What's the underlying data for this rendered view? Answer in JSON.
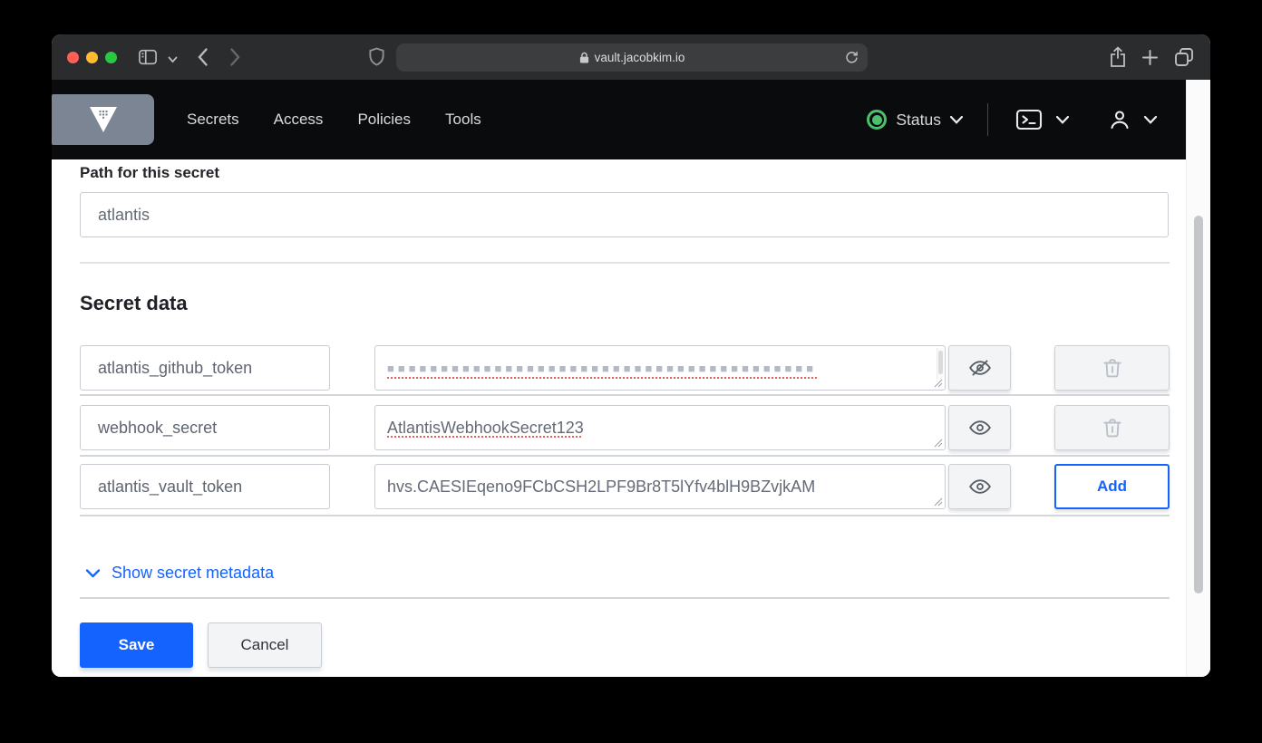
{
  "browser": {
    "url": "vault.jacobkim.io"
  },
  "nav": {
    "links": [
      "Secrets",
      "Access",
      "Policies",
      "Tools"
    ],
    "status_label": "Status"
  },
  "form": {
    "path_label": "Path for this secret",
    "path_value": "atlantis",
    "section_title": "Secret data",
    "rows": [
      {
        "key": "atlantis_github_token",
        "value": "■■■■■■■■■■■■■■■■■■■■■■■■■■■■■■■■■■■■■■■■",
        "masked": true
      },
      {
        "key": "webhook_secret",
        "value": "AtlantisWebhookSecret123",
        "masked": false
      },
      {
        "key": "atlantis_vault_token",
        "value": "hvs.CAESIEqeno9FCbCSH2LPF9Br8T5lYfv4blH9BZvjkAM",
        "masked": false
      }
    ],
    "metadata_toggle_label": "Show secret metadata",
    "add_label": "Add",
    "save_label": "Save",
    "cancel_label": "Cancel"
  },
  "colors": {
    "accent": "#1563ff",
    "status_green": "#4dbf6c",
    "nav_bg": "#0a0b0d",
    "titlebar_bg": "#2b2c2e"
  }
}
